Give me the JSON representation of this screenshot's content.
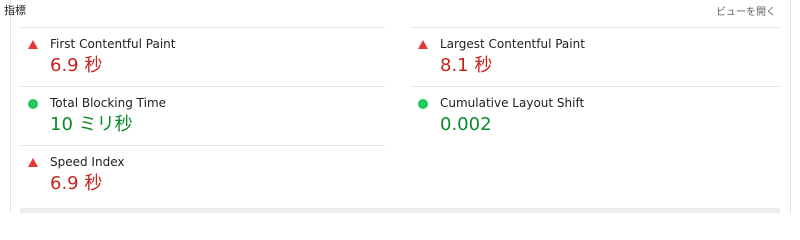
{
  "header": {
    "title": "指標",
    "toggle_label": "ビューを開く"
  },
  "colors": {
    "bad": "#c5221f",
    "good": "#0a8a2a",
    "triangle": "#e53935",
    "circle": "#1ec85a"
  },
  "metrics": {
    "fcp": {
      "label": "First Contentful Paint",
      "value": "6.9 秒",
      "status": "bad",
      "icon": "triangle-warning-icon"
    },
    "lcp": {
      "label": "Largest Contentful Paint",
      "value": "8.1 秒",
      "status": "bad",
      "icon": "triangle-warning-icon"
    },
    "tbt": {
      "label": "Total Blocking Time",
      "value": "10 ミリ秒",
      "status": "good",
      "icon": "green-circle-icon"
    },
    "cls": {
      "label": "Cumulative Layout Shift",
      "value": "0.002",
      "status": "good",
      "icon": "green-circle-icon"
    },
    "si": {
      "label": "Speed Index",
      "value": "6.9 秒",
      "status": "bad",
      "icon": "triangle-warning-icon"
    }
  }
}
